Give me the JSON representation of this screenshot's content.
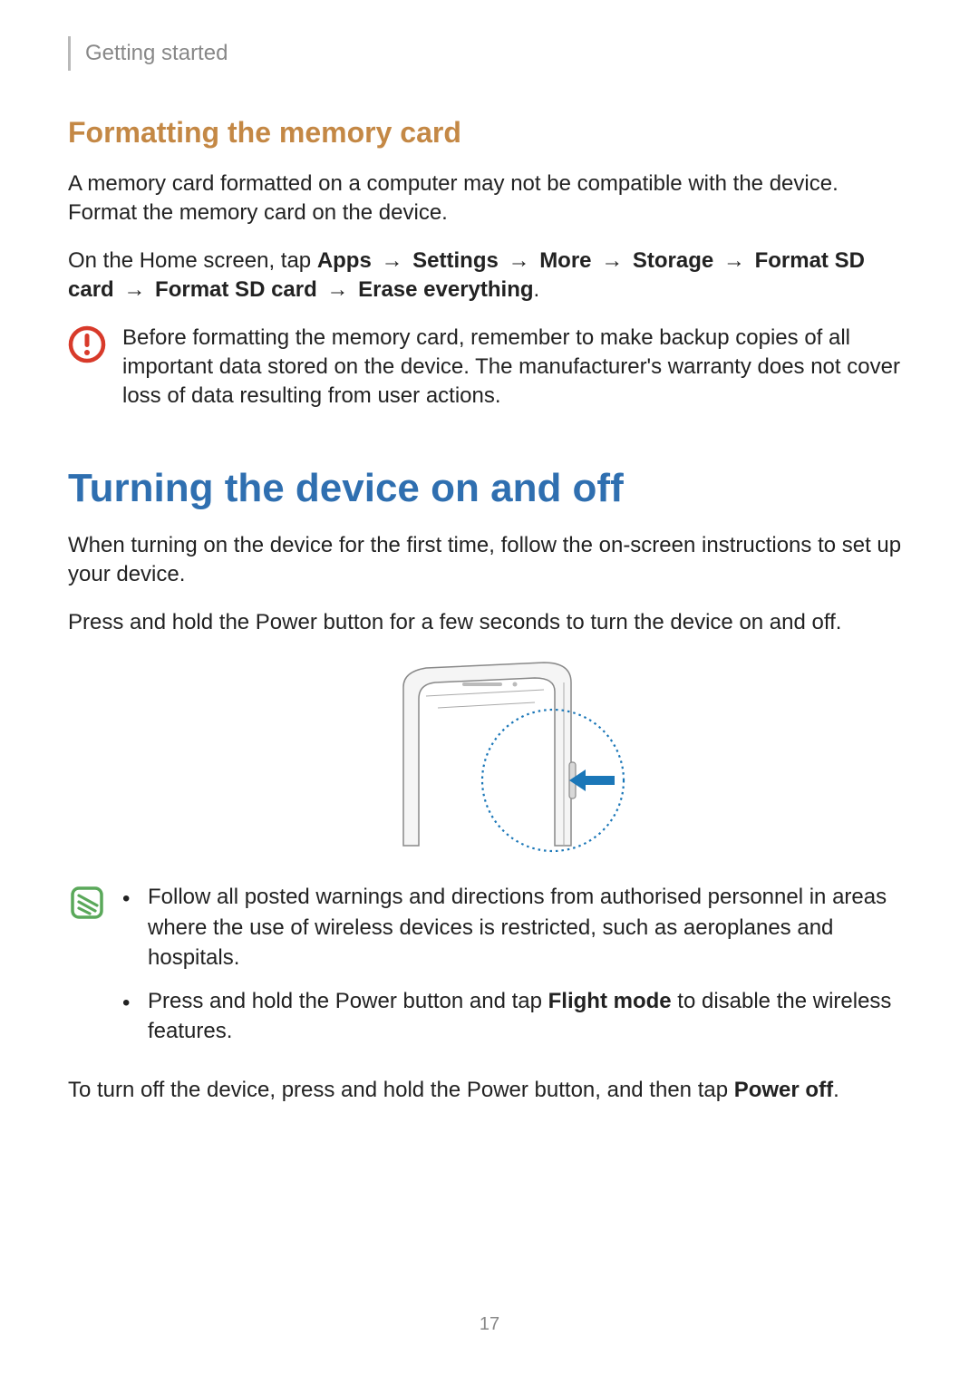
{
  "header": {
    "section": "Getting started"
  },
  "sub1": {
    "title": "Formatting the memory card",
    "p1": "A memory card formatted on a computer may not be compatible with the device. Format the memory card on the device.",
    "nav": {
      "prefix": "On the Home screen, tap ",
      "steps": [
        "Apps",
        "Settings",
        "More",
        "Storage",
        "Format SD card",
        "Format SD card",
        "Erase everything"
      ],
      "arrow": "→",
      "suffix": "."
    },
    "warning": "Before formatting the memory card, remember to make backup copies of all important data stored on the device. The manufacturer's warranty does not cover loss of data resulting from user actions."
  },
  "main": {
    "title": "Turning the device on and off",
    "p1": "When turning on the device for the first time, follow the on-screen instructions to set up your device.",
    "p2": "Press and hold the Power button for a few seconds to turn the device on and off.",
    "note_items": [
      {
        "text": "Follow all posted warnings and directions from authorised personnel in areas where the use of wireless devices is restricted, such as aeroplanes and hospitals."
      },
      {
        "pre": "Press and hold the Power button and tap ",
        "bold": "Flight mode",
        "post": " to disable the wireless features."
      }
    ],
    "p3": {
      "pre": "To turn off the device, press and hold the Power button, and then tap ",
      "bold": "Power off",
      "post": "."
    }
  },
  "page_number": "17",
  "icons": {
    "warning": "caution-icon",
    "note": "note-icon"
  },
  "colors": {
    "accent_orange": "#c48845",
    "accent_blue": "#2f6fb0",
    "caution_red": "#d83a2a",
    "note_green": "#5aa85a",
    "callout_blue": "#1b77b8"
  }
}
